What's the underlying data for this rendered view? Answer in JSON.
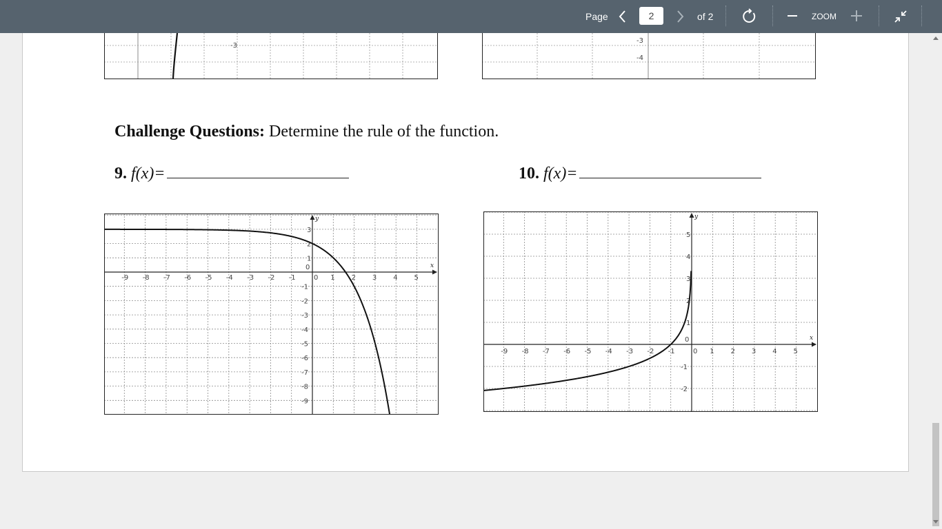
{
  "toolbar": {
    "page_label": "Page",
    "current_page": "2",
    "of_label": "of 2",
    "zoom_label": "ZOOM",
    "icons": [
      "chevron-left-icon",
      "chevron-right-icon",
      "refresh-icon",
      "minus-icon",
      "plus-icon",
      "collapse-icon"
    ]
  },
  "document": {
    "heading_bold": "Challenge Questions:",
    "heading_rest": " Determine the rule of the function.",
    "q9": {
      "number": "9.",
      "func": "f(x)="
    },
    "q10": {
      "number": "10.",
      "func": "f(x)="
    }
  },
  "plots": {
    "top_left": {
      "y_labels": [
        "-3"
      ]
    },
    "top_right": {
      "y_labels": [
        "-3",
        "-4"
      ]
    },
    "q9": {
      "axis_x": "x",
      "axis_y": "y",
      "x_ticks": [
        "-9",
        "-8",
        "-7",
        "-6",
        "-5",
        "-4",
        "-3",
        "-2",
        "-1",
        "0",
        "1",
        "2",
        "3",
        "4",
        "5"
      ],
      "y_ticks_pos": [
        "3",
        "2",
        "1",
        "0"
      ],
      "y_ticks_neg": [
        "-1",
        "-2",
        "-3",
        "-4",
        "-5",
        "-6",
        "-7",
        "-8",
        "-9"
      ],
      "asymptote_y": 3
    },
    "q10": {
      "axis_x": "x",
      "axis_y": "y",
      "x_ticks": [
        "-9",
        "-8",
        "-7",
        "-6",
        "-5",
        "-4",
        "-3",
        "-2",
        "-1",
        "0",
        "1",
        "2",
        "3",
        "4",
        "5"
      ],
      "y_ticks_pos": [
        "5",
        "4",
        "3",
        "2",
        "1",
        "0"
      ],
      "y_ticks_neg": [
        "-1",
        "-2"
      ],
      "vertical_asymptote_x": 0
    }
  }
}
